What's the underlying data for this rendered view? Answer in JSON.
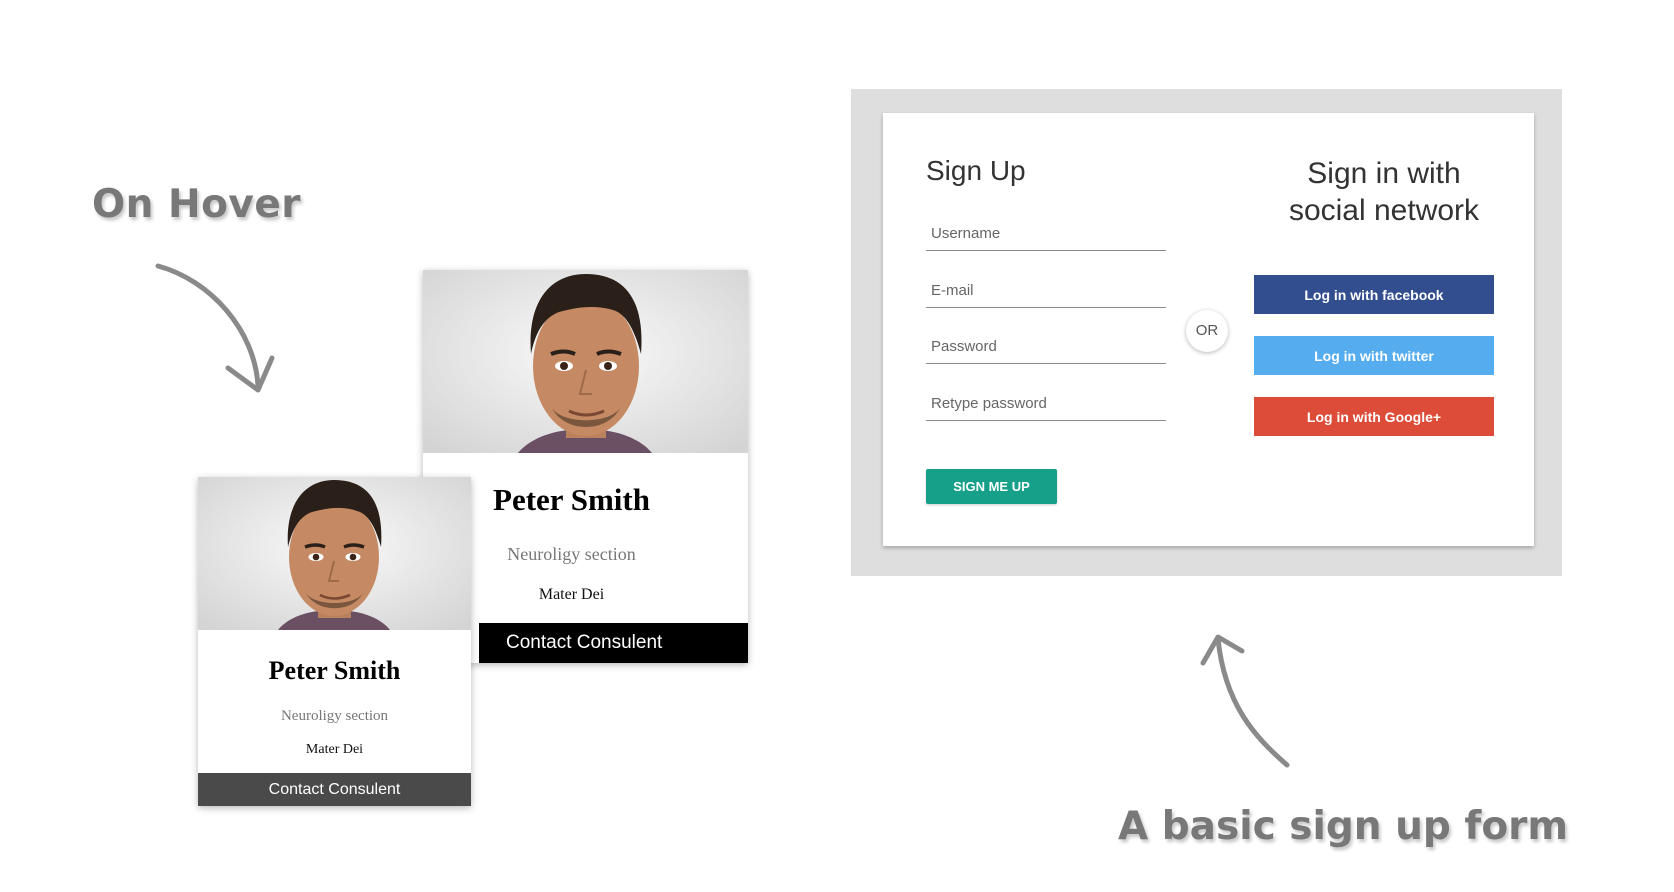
{
  "captions": {
    "on_hover": "On Hover",
    "basic_form": "A basic sign up form"
  },
  "cards": {
    "small": {
      "name": "Peter Smith",
      "department": "Neuroligy section",
      "organization": "Mater Dei",
      "contact_label": "Contact Consulent"
    },
    "large": {
      "name": "Peter Smith",
      "department": "Neuroligy section",
      "organization": "Mater Dei",
      "contact_label": "Contact Consulent"
    }
  },
  "signup": {
    "title": "Sign Up",
    "fields": {
      "username_placeholder": "Username",
      "email_placeholder": "E-mail",
      "password_placeholder": "Password",
      "retype_placeholder": "Retype password"
    },
    "submit_label": "SIGN ME UP",
    "or_label": "OR",
    "social_title": "Sign in with social network",
    "social": {
      "facebook_label": "Log in with facebook",
      "twitter_label": "Log in with twitter",
      "google_label": "Log in with Google+"
    }
  },
  "colors": {
    "facebook": "#324e8e",
    "twitter": "#55acee",
    "google": "#dd4b39",
    "submit": "#16a08a",
    "form_frame": "#dedede",
    "large_contact_bar": "#000000",
    "small_contact_bar": "#4a4a4a",
    "caption_text": "#787878"
  },
  "icons": {
    "hover_arrow": "curved-arrow-down-icon",
    "form_arrow": "curved-arrow-up-icon"
  }
}
